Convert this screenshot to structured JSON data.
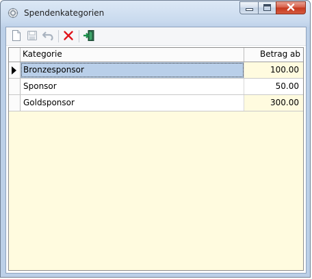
{
  "window": {
    "title": "Spendenkategorien",
    "icon": "gear-icon"
  },
  "toolbar": {
    "buttons": [
      {
        "name": "new",
        "icon": "new-document-icon"
      },
      {
        "name": "save",
        "icon": "save-icon"
      },
      {
        "name": "undo",
        "icon": "undo-icon"
      },
      {
        "name": "delete",
        "icon": "delete-x-icon",
        "color": "#e0141b"
      },
      {
        "name": "exit",
        "icon": "exit-door-icon",
        "color": "#1a8f4a"
      }
    ]
  },
  "grid": {
    "columns": [
      "Kategorie",
      "Betrag ab"
    ],
    "rows": [
      {
        "kategorie": "Bronzesponsor",
        "betrag": "100.00",
        "selected": true
      },
      {
        "kategorie": "Sponsor",
        "betrag": "50.00",
        "selected": false
      },
      {
        "kategorie": "Goldsponsor",
        "betrag": "300.00",
        "selected": false
      }
    ],
    "colors": {
      "background": "#fffbdf",
      "selection": "#b9cfe9"
    }
  }
}
